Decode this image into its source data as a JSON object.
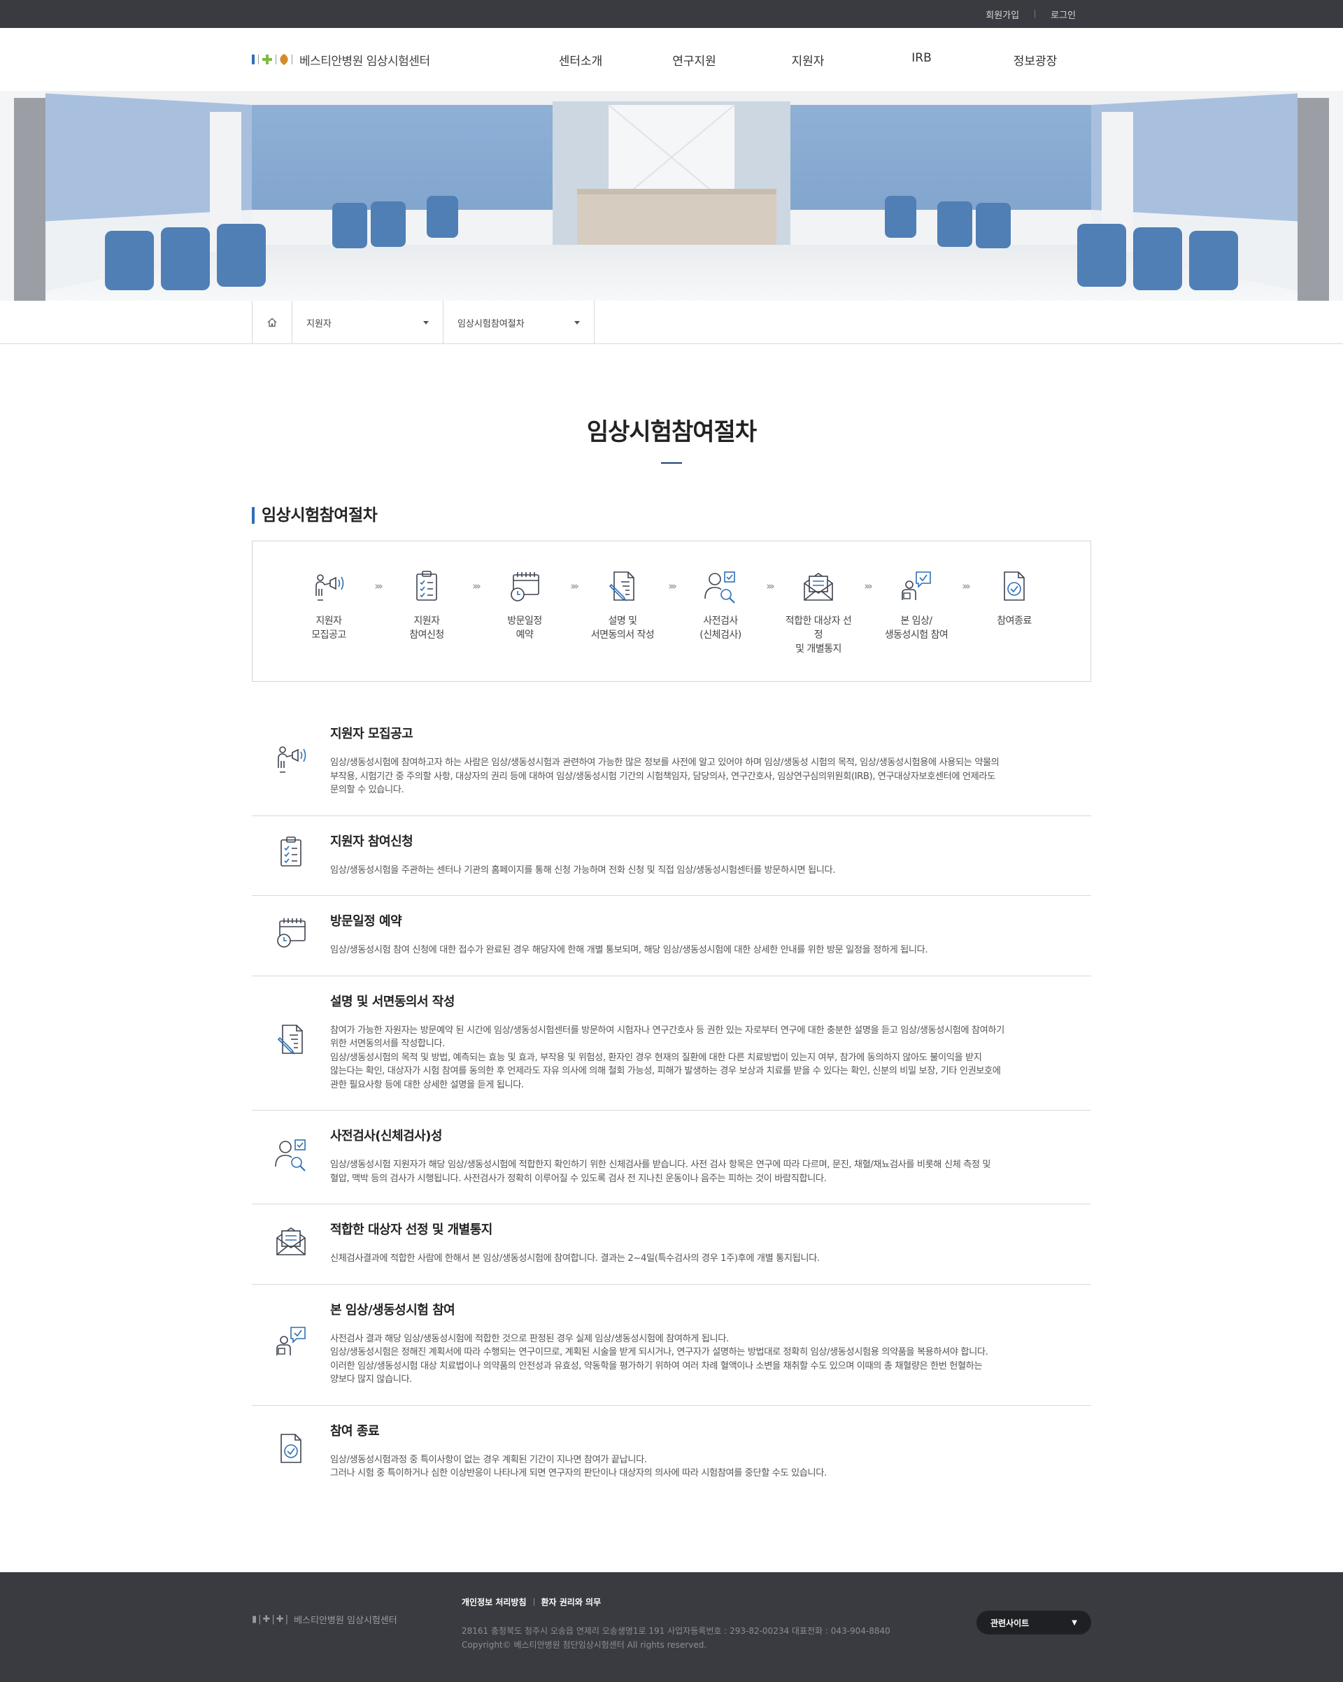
{
  "topbar": {
    "signup": "회원가입",
    "login": "로그인"
  },
  "header": {
    "logo_text": "베스티안병원 임상시험센터",
    "nav": [
      "센터소개",
      "연구지원",
      "지원자",
      "IRB",
      "정보광장"
    ]
  },
  "location": {
    "depth1": "지원자",
    "depth2": "임상시험참여절차"
  },
  "page_title": "임상시험참여절차",
  "section_title": "임상시험참여절차",
  "process": [
    {
      "icon": "megaphone-person-icon",
      "label": "지원자\n모집공고"
    },
    {
      "icon": "clipboard-checklist-icon",
      "label": "지원자\n참여신청"
    },
    {
      "icon": "calendar-clock-icon",
      "label": "방문일정\n예약"
    },
    {
      "icon": "document-pen-icon",
      "label": "설명 및\n서면동의서 작성"
    },
    {
      "icon": "person-search-icon",
      "label": "사전검사\n(신체검사)"
    },
    {
      "icon": "envelope-letter-icon",
      "label": "적합한 대상자 선정\n및 개별통지"
    },
    {
      "icon": "person-chat-check-icon",
      "label": "본 임상/\n생동성시험 참여"
    },
    {
      "icon": "document-check-icon",
      "label": "참여종료"
    }
  ],
  "details": [
    {
      "icon": "megaphone-person-icon",
      "title": "지원자 모집공고",
      "text": "임상/생동성시험에 참여하고자 하는 사람은 임상/생동성시험과 관련하여 가능한 많은 정보를 사전에 알고 있어야 하며 임상/생동성 시험의 목적, 임상/생동성시험용에 사용되는 약물의\n부작용, 시험기간 중 주의할 사항, 대상자의 권리 등에 대하여 임상/생동성시험 기간의 시험책임자, 담당의사, 연구간호사, 임상연구심의위원회(IRB), 연구대상자보호센터에 언제라도\n문의할 수 있습니다."
    },
    {
      "icon": "clipboard-checklist-icon",
      "title": "지원자 참여신청",
      "text": "임상/생동성시험을 주관하는 센터나 기관의 홈페이지를 통해 신청 가능하며 전화 신청 및 직접 임상/생동성시험센터를 방문하시면 됩니다."
    },
    {
      "icon": "calendar-clock-icon",
      "title": "방문일정 예약",
      "text": "임상/생동성시험 참여 신청에 대한 접수가 완료된 경우 해당자에 한해 개별 통보되며, 해당 임상/생동성시험에 대한 상세한 안내를 위한 방문 일정을 정하게 됩니다."
    },
    {
      "icon": "document-pen-icon",
      "title": "설명 및 서면동의서 작성",
      "text": "참여가 가능한 자원자는 방문예약 된 시간에 임상/생동성시험센터를 방문하여 시험자나 연구간호사 등 권한 있는 자로부터 연구에 대한 충분한 설명을 듣고 임상/생동성시험에 참여하기\n위한 서면동의서를 작성합니다.\n임상/생동성시험의 목적 및 방법, 예측되는 효능 및 효과, 부작용 및 위험성, 환자인 경우 현재의 질환에 대한 다른 치료방법이 있는지 여부, 참가에 동의하지 않아도 불이익을 받지\n않는다는 확인, 대상자가 시험 참여를 동의한 후 언제라도 자유 의사에 의해 철회 가능성, 피해가 발생하는 경우 보상과 치료를 받을 수 있다는 확인, 신분의 비밀 보장, 기타 인권보호에\n관한 필요사항 등에 대한 상세한 설명을 듣게 됩니다."
    },
    {
      "icon": "person-search-icon",
      "title": "사전검사(신체검사)성",
      "text": "임상/생동성시험 지원자가 해당 임상/생동성시험에 적합한지 확인하기 위한 신체검사를 받습니다. 사전 검사 항목은 연구에 따라 다르며, 문진, 채혈/채뇨검사를 비롯해 신체 측정 및\n혈압, 맥박 등의 검사가 시행됩니다. 사전검사가 정확히 이루어질 수 있도록 검사 전 지나친 운동이나 음주는 피하는 것이 바람직합니다."
    },
    {
      "icon": "envelope-letter-icon",
      "title": "적합한 대상자 선정 및 개별통지",
      "text": "신체검사결과에 적합한 사람에 한해서 본 임상/생동성시험에 참여합니다. 결과는 2~4일(특수검사의 경우 1주)후에 개별 통지됩니다."
    },
    {
      "icon": "person-chat-check-icon",
      "title": "본 임상/생동성시험 참여",
      "text": "사전검사 결과 해당 임상/생동성시험에 적합한 것으로 판정된 경우 실제 임상/생동성시험에 참여하게 됩니다.\n임상/생동성시험은 정해진 계획서에 따라 수행되는 연구이므로, 계획된 시술을 받게 되시거나, 연구자가 설명하는 방법대로 정확히 임상/생동성시험용 의약품을 복용하셔야 합니다.\n이러한 임상/생동성시험 대상 치료법이나 의약품의 안전성과 유효성, 약동학을 평가하기 위하여 여러 차례 혈액이나 소변을 채취할 수도 있으며 이때의 총 채혈량은 한번 헌혈하는\n양보다 많지 않습니다."
    },
    {
      "icon": "document-check-icon",
      "title": "참여 종료",
      "text": "임상/생동성시험과정 중 특이사항이 없는 경우 계획된 기간이 지나면 참여가 끝납니다.\n그러나 시험 중 특이하거나 심한 이상반응이 나타나게 되면 연구자의 판단이나 대상자의 의사에 따라 시험참여를 중단할 수도 있습니다."
    }
  ],
  "footer": {
    "logo_text": "베스티안병원 임상시험센터",
    "privacy_link": "개인정보 처리방침",
    "rights_link": "환자 권리와 의무",
    "address": "28161 충청북도 청주시 오송읍 연제리 오송생명1로 191   사업자등록번호 : 293-82-00234   대표전화 : 043-904-8840",
    "copyright": "Copyright© 베스티안병원 첨단임상시험센터  All rights reserved.",
    "related_sites": "관련사이트"
  },
  "colors": {
    "accent": "#2e6fb6",
    "dark": "#3a3b40",
    "title_line": "#1f3f77"
  }
}
